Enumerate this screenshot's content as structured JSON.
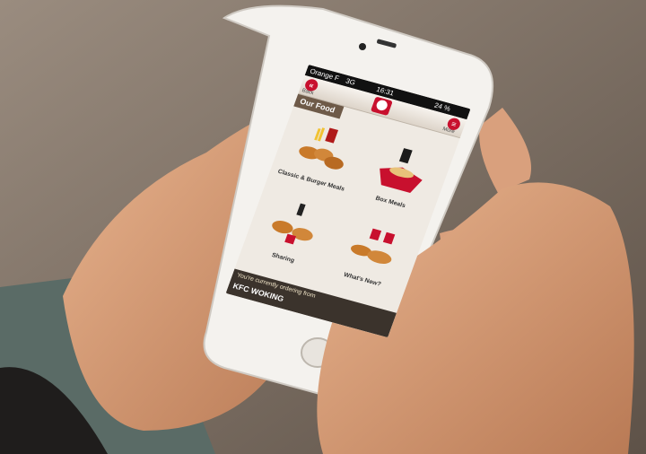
{
  "status_bar": {
    "carrier": "Orange F",
    "network": "3G",
    "time": "16:31",
    "battery": "24 %"
  },
  "nav": {
    "back_label": "Back",
    "more_label": "More"
  },
  "section": {
    "title": "Our Food"
  },
  "menu": [
    {
      "label": "Classic & Burger Meals",
      "icon": "meal-photo"
    },
    {
      "label": "Box Meals",
      "icon": "box-meal-photo"
    },
    {
      "label": "Sharing",
      "icon": "sharing-photo"
    },
    {
      "label": "What's New?",
      "icon": "new-items-photo"
    }
  ],
  "footer": {
    "notice": "You're currently ordering from",
    "store": "KFC WOKING"
  },
  "colors": {
    "brand_red": "#c8102e",
    "tab_brown": "#6e5a48",
    "screen_bg": "#efeae3"
  }
}
